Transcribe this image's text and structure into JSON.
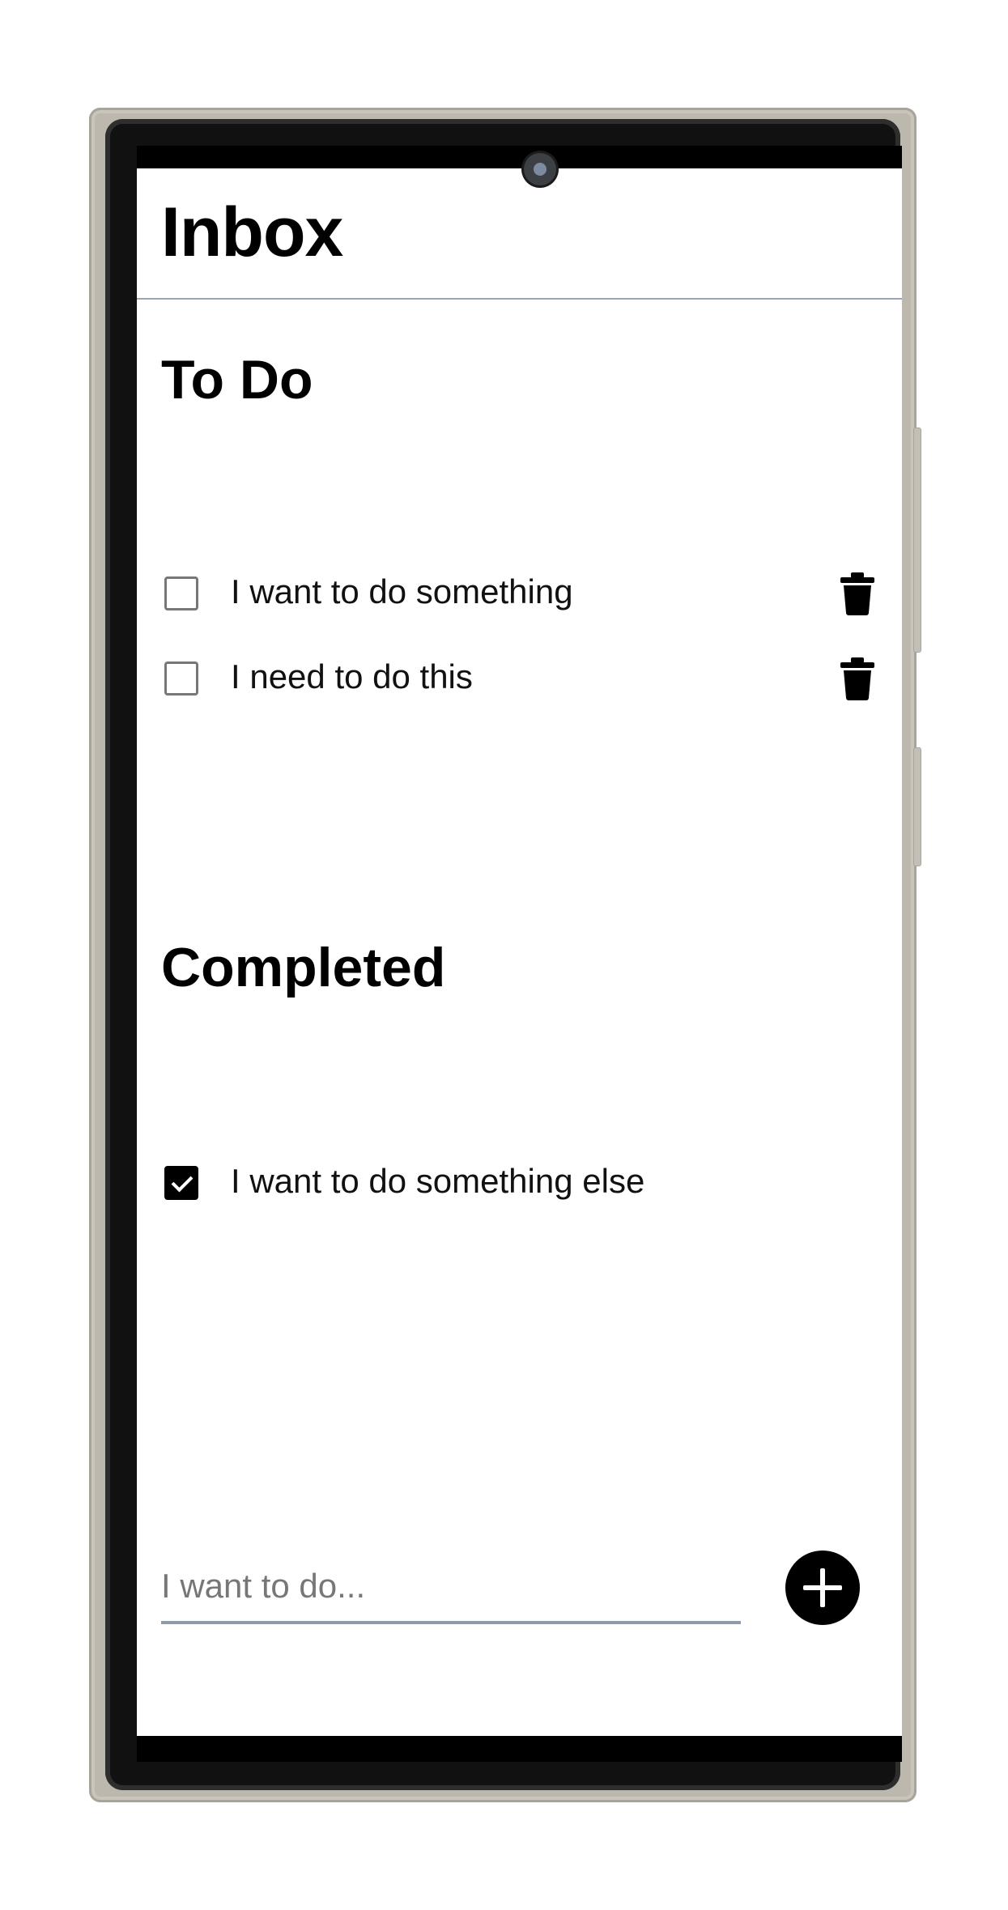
{
  "header": {
    "title": "Inbox"
  },
  "todo": {
    "title": "To Do",
    "items": [
      {
        "label": "I want to do something",
        "checked": false
      },
      {
        "label": "I need to do this",
        "checked": false
      }
    ]
  },
  "completed": {
    "title": "Completed",
    "items": [
      {
        "label": "I want to do something else",
        "checked": true
      }
    ]
  },
  "composer": {
    "placeholder": "I want to do...",
    "value": ""
  },
  "icons": {
    "delete": "trash-icon",
    "add": "plus-icon",
    "check": "check-icon"
  },
  "colors": {
    "accent": "#000000",
    "divider": "#9aa6b2",
    "input_underline": "#8f9ba8",
    "frame": "#bdb8ae"
  }
}
